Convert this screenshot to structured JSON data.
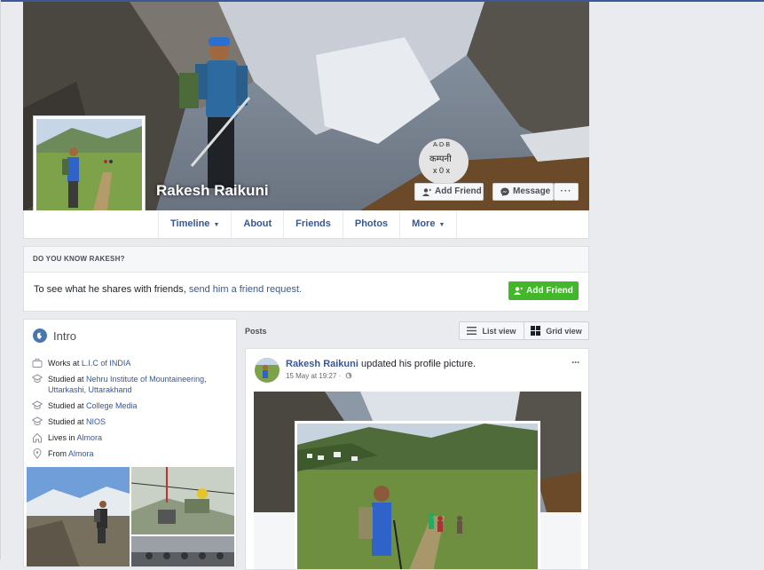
{
  "profile": {
    "name": "Rakesh Raikuni",
    "add_friend_label": "Add Friend",
    "message_label": "Message",
    "more_dots": "···"
  },
  "nav": {
    "tabs": [
      {
        "label": "Timeline",
        "has_caret": true
      },
      {
        "label": "About"
      },
      {
        "label": "Friends"
      },
      {
        "label": "Photos"
      },
      {
        "label": "More",
        "has_caret": true
      }
    ],
    "caret": "▼"
  },
  "know": {
    "heading": "DO YOU KNOW RAKESH?",
    "text_before": "To see what he shares with friends, ",
    "link": "send him a friend request.",
    "button": "Add Friend"
  },
  "intro": {
    "title": "Intro",
    "rows": [
      {
        "icon": "briefcase-icon",
        "prefix": "Works at ",
        "link": "L.I.C of INDIA"
      },
      {
        "icon": "graduation-cap-icon",
        "prefix": "Studied at ",
        "link": "Nehru Institute of Mountaineering, Uttarkashi, Uttarakhand"
      },
      {
        "icon": "graduation-cap-icon",
        "prefix": "Studied at ",
        "link": "College Media"
      },
      {
        "icon": "graduation-cap-icon",
        "prefix": "Studied at ",
        "link": "NIOS"
      },
      {
        "icon": "home-icon",
        "prefix": "Lives in ",
        "link": "Almora"
      },
      {
        "icon": "location-pin-icon",
        "prefix": "From ",
        "link": "Almora"
      }
    ]
  },
  "posts": {
    "label": "Posts",
    "list_view": "List view",
    "grid_view": "Grid view",
    "post": {
      "author": "Rakesh Raikuni",
      "action": " updated his profile picture.",
      "time": "15 May at 19:27 ·",
      "menu": "···"
    }
  },
  "colors": {
    "brand": "#3b5998",
    "link": "#365899",
    "green": "#42b72a",
    "background": "#e9ebee"
  }
}
